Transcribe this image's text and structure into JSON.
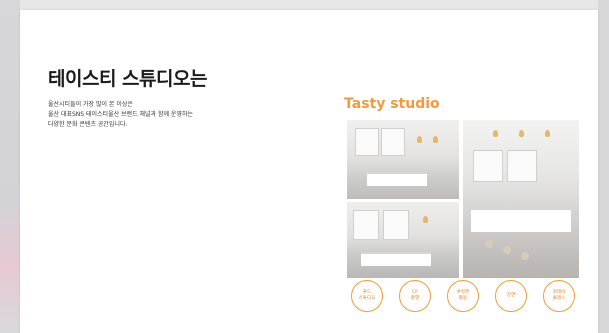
{
  "slide": {
    "title": "테이스티 스튜디오는",
    "description": [
      "울산시티들이 가장 많이 본 이상은",
      "울산 대표SNS 테이스티울산 브랜드 채널과 함께 운영하는",
      "다양한 문화 콘텐츠 공간입니다."
    ],
    "brand": "Tasty studio",
    "features": [
      "푸드\n스튜디오",
      "CF\n촬영",
      "쿠킹존\n활동",
      "강연",
      "원데이\n클래스"
    ]
  },
  "colors": {
    "accent": "#f19a3e",
    "background": "#ffffff",
    "title": "#1b1b1b"
  }
}
